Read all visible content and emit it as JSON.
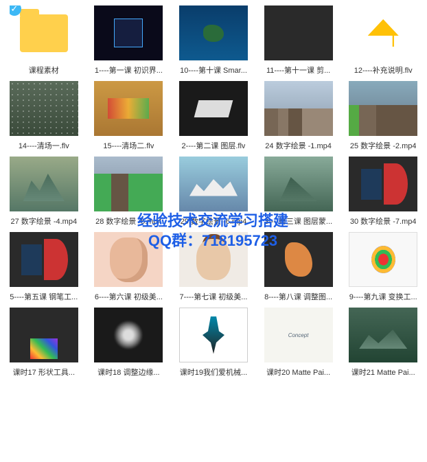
{
  "watermark": {
    "line1": "经验技术交流学习搭建",
    "line2": "QQ群：718195723"
  },
  "items": [
    {
      "label": "课程素材",
      "type": "folder",
      "selected": true
    },
    {
      "label": "1----第一课 初识界...",
      "thumb": "t1"
    },
    {
      "label": "10----第十课 Smar...",
      "thumb": "t2"
    },
    {
      "label": "11----第十一课 剪...",
      "thumb": "t3"
    },
    {
      "label": "12----补充说明.flv",
      "thumb": "t4"
    },
    {
      "label": "14----清场一.flv",
      "thumb": "t5"
    },
    {
      "label": "15----清场二.flv",
      "thumb": "t6"
    },
    {
      "label": "2----第二课 图层.flv",
      "thumb": "t7"
    },
    {
      "label": "24 数字绘景 -1.mp4",
      "thumb": "t8"
    },
    {
      "label": "25 数字绘景 -2.mp4",
      "thumb": "t9"
    },
    {
      "label": "27 数字绘景 -4.mp4",
      "thumb": "t10"
    },
    {
      "label": "28 数字绘景 -5.mp4",
      "thumb": "t11"
    },
    {
      "label": "29 数字绘景 -6.mp4",
      "thumb": "t12"
    },
    {
      "label": "3----第三课 图层蒙...",
      "thumb": "t13"
    },
    {
      "label": "30 数字绘景 -7.mp4",
      "thumb": "t14"
    },
    {
      "label": "5----第五课 钢笔工...",
      "thumb": "t14"
    },
    {
      "label": "6----第六课 初级美...",
      "thumb": "t15"
    },
    {
      "label": "7----第七课 初级美...",
      "thumb": "t16"
    },
    {
      "label": "8----第八课 调整图...",
      "thumb": "t17"
    },
    {
      "label": "9----第九课 变换工...",
      "thumb": "t18"
    },
    {
      "label": "课时17 形状工具...",
      "thumb": "t19"
    },
    {
      "label": "课时18 调整边缘...",
      "thumb": "t20"
    },
    {
      "label": "课时19我们爱机械...",
      "thumb": "t21"
    },
    {
      "label": "课时20 Matte Pai...",
      "thumb": "t22"
    },
    {
      "label": "课时21 Matte Pai...",
      "thumb": "t23"
    }
  ]
}
